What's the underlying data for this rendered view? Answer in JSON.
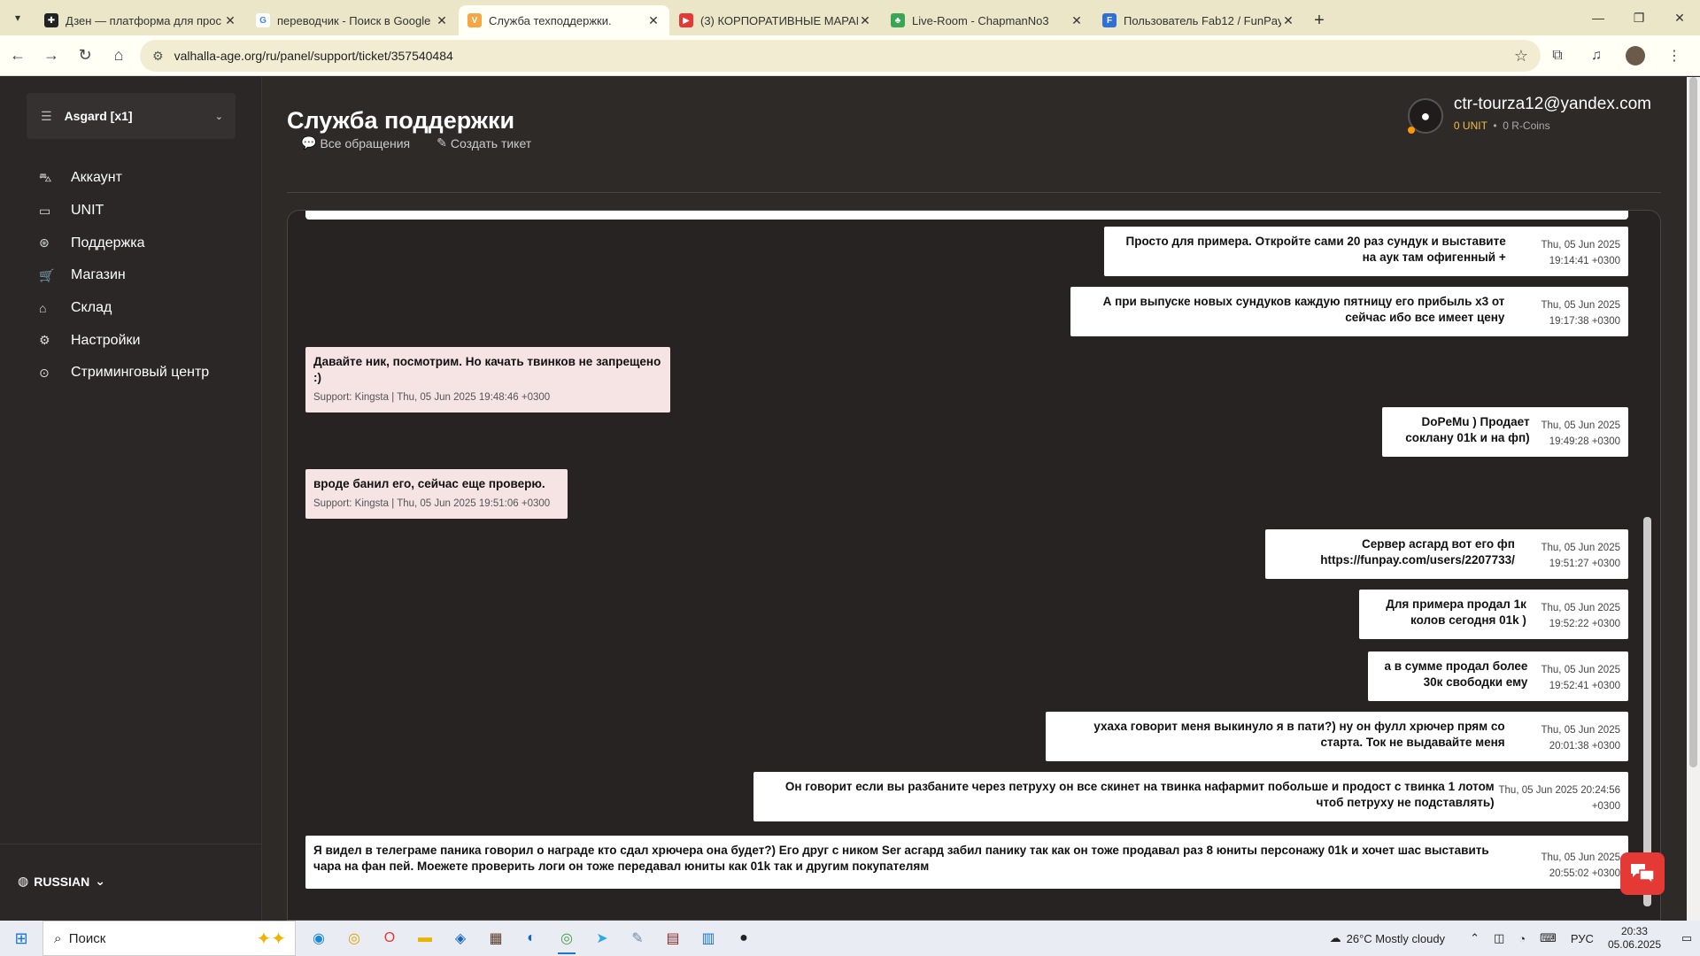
{
  "browser": {
    "tabs": [
      {
        "title": "Дзен — платформа для прос",
        "fav_color": "#222222",
        "fav_glyph": "✚",
        "active": false
      },
      {
        "title": "переводчик - Поиск в Google",
        "fav_color": "#ffffff",
        "fav_glyph": "G",
        "active": false
      },
      {
        "title": "Служба техподдержки.",
        "fav_color": "#f4a742",
        "fav_glyph": "V",
        "active": true
      },
      {
        "title": "(3) КОРПОРАТИВНЫЕ МАРАМ",
        "fav_color": "#e53935",
        "fav_glyph": "▶",
        "active": false
      },
      {
        "title": "Live-Room - ChapmanNo3",
        "fav_color": "#3aa655",
        "fav_glyph": "♣",
        "active": false
      },
      {
        "title": "Пользователь Fab12 / FunPay",
        "fav_color": "#2f6fd6",
        "fav_glyph": "F",
        "active": false
      }
    ],
    "url": "valhalla-age.org/ru/panel/support/ticket/357540484"
  },
  "sidebar": {
    "server": "Asgard [x1]",
    "items": [
      {
        "label": "Аккаунт",
        "icon": "car-icon",
        "glyph": "⛍"
      },
      {
        "label": "UNIT",
        "icon": "wallet-icon",
        "glyph": "▭"
      },
      {
        "label": "Поддержка",
        "icon": "lifebuoy-icon",
        "glyph": "⊛"
      },
      {
        "label": "Магазин",
        "icon": "cart-icon",
        "glyph": "🛒"
      },
      {
        "label": "Склад",
        "icon": "home-icon",
        "glyph": "⌂"
      },
      {
        "label": "Настройки",
        "icon": "gear-icon",
        "glyph": "⚙"
      },
      {
        "label": "Стриминговый центр",
        "icon": "play-circle-icon",
        "glyph": "⊙"
      }
    ],
    "language": "RUSSIAN"
  },
  "header": {
    "title": "Служба поддержки",
    "email": "ctr-tourza12@yandex.com",
    "unit": "0 UNIT",
    "rcoins": "0 R-Coins",
    "tab_all": "Все обращения",
    "tab_create": "Создать тикет"
  },
  "messages": [
    {
      "side": "user",
      "text": "Просто для примера. Откройте сами 20 раз сундук и выставите на аук там офигенный +",
      "meta": "Thu, 05 Jun 2025 19:14:41 +0300"
    },
    {
      "side": "user",
      "text": "А при выпуске новых сундуков каждую пятницу его прибыль х3 от сейчас ибо все имеет цену",
      "meta": "Thu, 05 Jun 2025 19:17:38 +0300"
    },
    {
      "side": "sup",
      "text": "Давайте ник, посмотрим. Но качать твинков не запрещено :)",
      "meta": "Support: Kingsta | Thu, 05 Jun 2025 19:48:46 +0300"
    },
    {
      "side": "user",
      "text": "DoPeMu ) Продает соклану 01k и на фп)",
      "meta": "Thu, 05 Jun 2025 19:49:28 +0300"
    },
    {
      "side": "sup",
      "text": "вроде банил его, сейчас еще проверю.",
      "meta": "Support: Kingsta | Thu, 05 Jun 2025 19:51:06 +0300"
    },
    {
      "side": "user",
      "text": "Сервер асгард вот его фп https://funpay.com/users/2207733/",
      "meta": "Thu, 05 Jun 2025 19:51:27 +0300"
    },
    {
      "side": "user",
      "text": "Для примера продал 1к колов сегодня 01k )",
      "meta": "Thu, 05 Jun 2025 19:52:22 +0300"
    },
    {
      "side": "user",
      "text": "а в сумме продал более 30к свободки ему",
      "meta": "Thu, 05 Jun 2025 19:52:41 +0300"
    },
    {
      "side": "user",
      "text": "ухаха говорит меня выкинуло я в пати?) ну он фулл хрючер прям со старта. Ток не выдавайте меня",
      "meta": "Thu, 05 Jun 2025 20:01:38 +0300"
    },
    {
      "side": "user",
      "text": "Он говорит если вы разбаните через петруху он все скинет на твинка нафармит побольше и продост с твинка 1 лотом чтоб петруху не подставлять)",
      "meta": "Thu, 05 Jun 2025 20:24:56 +0300"
    },
    {
      "side": "user",
      "text": "Я видел в телеграме паника говорил о награде кто сдал хрючера она будет?) Его друг с ником Ser асгард забил панику так как он тоже продавал раз 8 юниты персонажу 01k и хочет шас выставить чара на фан пей. Моежете проверить логи он тоже передавал юниты как 01k так и другим покупателям",
      "meta": "Thu, 05 Jun 2025 20:55:02 +0300"
    }
  ],
  "taskbar": {
    "search": "Поиск",
    "weather": "26°C  Mostly cloudy",
    "lang": "РУС",
    "time": "20:33",
    "date": "05.06.2025"
  }
}
